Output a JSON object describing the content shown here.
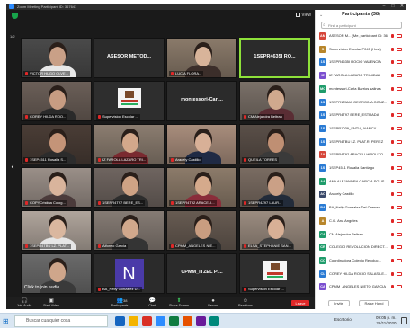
{
  "window": {
    "title": "Zoom Meeting Participant ID: 367641"
  },
  "view_button": "View",
  "tiles": [
    {
      "label": "VICTOR HUGO OLVE...",
      "center": "",
      "bg": "#4a4a4a",
      "skin": "#c9a087",
      "shirt": "#e8e8e8",
      "type": "person"
    },
    {
      "label": "",
      "center": "ASESOR METOD...",
      "bg": "#2b2b2b",
      "type": "name"
    },
    {
      "label": "LUCIA FLORA...",
      "center": "",
      "bg": "#8a7a6a",
      "skin": "#d8b49a",
      "shirt": "#3b2e2a",
      "type": "person"
    },
    {
      "label": "",
      "center": "1SEPR4635I RO...",
      "bg": "#2b2b2b",
      "type": "name",
      "active": true
    },
    {
      "label": "COREY HILDA ROO...",
      "center": "",
      "bg": "#6b5f58",
      "skin": "#c79c82",
      "shirt": "#2a2a2a",
      "type": "person"
    },
    {
      "label": "Supervision Escolar ...",
      "center": "",
      "bg": "#2e2e2e",
      "type": "logo"
    },
    {
      "label": "",
      "center": "montessori-Carl...",
      "bg": "#2b2b2b",
      "type": "name"
    },
    {
      "label": "CM Alejandra Beltran",
      "center": "",
      "bg": "#7a7068",
      "skin": "#d0a98e",
      "shirt": "#5a2d34",
      "type": "person"
    },
    {
      "label": "1SEP4511 Rosalia S...",
      "center": "",
      "bg": "#4a3d36",
      "skin": "#c49478",
      "shirt": "#2c2c2c",
      "type": "person"
    },
    {
      "label": "IZ FAROLA LAZARO TRI...",
      "center": "",
      "bg": "#8b7d70",
      "skin": "#d3a88b",
      "shirt": "#7a2a30",
      "type": "person"
    },
    {
      "label": "Aracely Castillo",
      "center": "",
      "bg": "#a88d7c",
      "skin": "#d8b097",
      "shirt": "#1f2a44",
      "type": "person"
    },
    {
      "label": "QUEILA TORRES",
      "center": "",
      "bg": "#5a4f48",
      "skin": "#bf8f73",
      "shirt": "#3a3a3a",
      "type": "person"
    },
    {
      "label": "COPYCristina Colog...",
      "center": "",
      "bg": "#9a8f88",
      "skin": "#d9b49c",
      "shirt": "#4b3b3b",
      "type": "person"
    },
    {
      "label": "1SEPR4T97 BERE_ES...",
      "center": "",
      "bg": "#6f6560",
      "skin": "#cfa385",
      "shirt": "#2d2d2d",
      "type": "person"
    },
    {
      "label": "1SEPR4T92 ARACELI...",
      "center": "",
      "bg": "#8c7b6a",
      "skin": "#d5aa8c",
      "shirt": "#8a2d3a",
      "type": "person"
    },
    {
      "label": "1SEPR4Z97 LAUR...",
      "center": "",
      "bg": "#7a6c62",
      "skin": "#caa086",
      "shirt": "#222b3a",
      "type": "person"
    },
    {
      "label": "1SEPR4TBU LZ. PLAT...",
      "center": "",
      "bg": "#b0a59c",
      "skin": "#dab79f",
      "shirt": "#e6e6e6",
      "type": "person"
    },
    {
      "label": "Alfonzo Garcia",
      "center": "",
      "bg": "#857b74",
      "skin": "#d1a88c",
      "shirt": "#343434",
      "type": "person"
    },
    {
      "label": "CPMM_ANGELES NIE...",
      "center": "",
      "bg": "#675b52",
      "skin": "#c99d80",
      "shirt": "#2d2d2d",
      "type": "person"
    },
    {
      "label": "ELSA_STEPHANIE SAN...",
      "center": "",
      "bg": "#9b8c80",
      "skin": "#d8b096",
      "shirt": "#404040",
      "type": "person"
    },
    {
      "label": "",
      "center": "",
      "bg": "#6a6a6a",
      "skin": "#cfa68b",
      "shirt": "#3a3a3a",
      "type": "person"
    },
    {
      "label": "BA_Nelly Gonzalez D...",
      "center": "",
      "bg": "#2b2b2b",
      "type": "letter",
      "letter": "N"
    },
    {
      "label": "",
      "center": "CPMM_ITZEL Pi...",
      "bg": "#2b2b2b",
      "type": "name"
    },
    {
      "label": "Supervision Escolar ...",
      "center": "",
      "bg": "#2e2e2e",
      "type": "logo"
    }
  ],
  "click_to_join": "Click to join audio",
  "toolbar": {
    "items": [
      {
        "label": "Join Audio",
        "icon": "🎧"
      },
      {
        "label": "Start Video",
        "icon": "▣"
      },
      {
        "label": "Participants",
        "icon": "👥"
      },
      {
        "label": "Chat",
        "icon": "💬"
      },
      {
        "label": "Share Screen",
        "icon": "⬆"
      },
      {
        "label": "Record",
        "icon": "●"
      },
      {
        "label": "Reactions",
        "icon": "☺"
      }
    ],
    "participant_count": "38",
    "end": "Leave"
  },
  "panel": {
    "title": "Participants (38)",
    "find_placeholder": "Find a participant",
    "participants": [
      {
        "initials": "AM",
        "color": "#d6463a",
        "name": "ASESOR M... (Me, participant ID: 367641)"
      },
      {
        "initials": "S",
        "color": "#b8862b",
        "name": "Supervision Escolar P045 (Host)"
      },
      {
        "initials": "1S",
        "color": "#2a7bd4",
        "name": "1SEPR4635I ROCIO VALENCIA"
      },
      {
        "initials": "IZ",
        "color": "#7b4fd0",
        "name": "IZ FAROLA LAZARO TRINIDAD"
      },
      {
        "initials": "MC",
        "color": "#1f9c6b",
        "name": "montessori-Carla Barrios salinas"
      },
      {
        "initials": "1S",
        "color": "#2a7bd4",
        "name": "1SEPR1TAMA GEORGINA GONZ..."
      },
      {
        "initials": "1S",
        "color": "#2a7bd4",
        "name": "1SEPR4T97 BERE_ESTRADA"
      },
      {
        "initials": "1S",
        "color": "#2a7bd4",
        "name": "1SEPR1039_SNTV_ NANCY"
      },
      {
        "initials": "1S",
        "color": "#2a7bd4",
        "name": "1SEPR4TBU LZ. PLAT.R. PEREZ"
      },
      {
        "initials": "1A",
        "color": "#d6463a",
        "name": "1SEPR4T92 ARACELI HIPOLITO"
      },
      {
        "initials": "1S",
        "color": "#2a7bd4",
        "name": "1SEP4511 Rosalia Santiago"
      },
      {
        "initials": "AA",
        "color": "#1f9c6b",
        "name": "ANA ALEJANDRA GARCIA SOLIS"
      },
      {
        "initials": "AC",
        "color": "#3a4a6a",
        "name": "Aracely Castillo"
      },
      {
        "initials": "BA",
        "color": "#2a7bd4",
        "name": "BA_Nelly Gonzalez Del Carmen"
      },
      {
        "initials": "A",
        "color": "#b8862b",
        "name": "C.G. Ana Angeles"
      },
      {
        "initials": "CA",
        "color": "#1f9c6b",
        "name": "CM Alejandra Beltran"
      },
      {
        "initials": "CR",
        "color": "#1f9c6b",
        "name": "COLEGIO REVOLUCION DIRECT..."
      },
      {
        "initials": "CC",
        "color": "#1f9c6b",
        "name": "Coordinadora Colegio Revoluc..."
      },
      {
        "initials": "CL",
        "color": "#2a7bd4",
        "name": "COREY HILDA ROCIO SALAS LE..."
      },
      {
        "initials": "CA",
        "color": "#7b4fd0",
        "name": "CPMM_ANGELES NIETO GARCIA"
      }
    ],
    "invite": "Invite",
    "raise_hand": "Raise Hand"
  },
  "taskbar": {
    "search": "Buscar cualquier cosa",
    "tray_text": "Escritorio",
    "time": "09:05 p. m.",
    "date": "26/11/2020",
    "apps": [
      "#1565c0",
      "#f4b400",
      "#d93025",
      "#2d8cff",
      "#107c41",
      "#e65100",
      "#6a1b9a",
      "#00897b"
    ]
  }
}
